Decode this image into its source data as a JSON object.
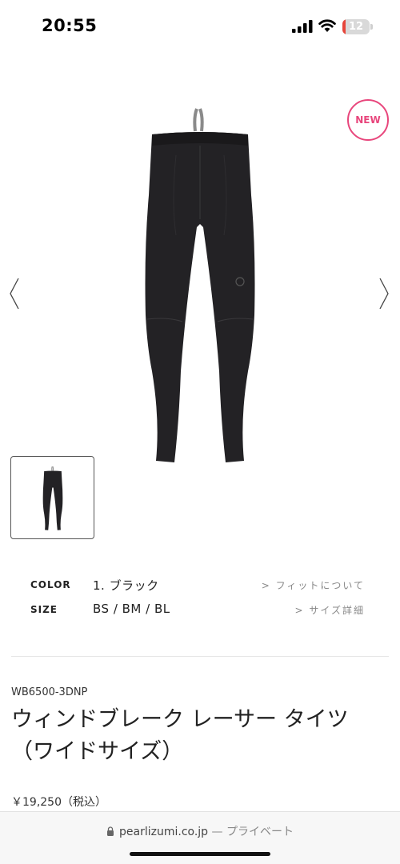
{
  "status_bar": {
    "time": "20:55",
    "battery_level": "12",
    "battery_fraction": 0.12,
    "battery_color": "#e6453a",
    "icons": [
      "signal-icon",
      "wifi-icon",
      "battery-icon"
    ]
  },
  "hero": {
    "badge": "NEW",
    "badge_color": "#e8467c",
    "prev_icon": "chevron-left-icon",
    "next_icon": "chevron-right-icon"
  },
  "specs": {
    "color_label": "COLOR",
    "color_value": "1. ブラック",
    "fit_link": "> フィットについて",
    "size_label": "SIZE",
    "size_value": "BS / BM / BL",
    "size_link": "> サイズ詳細"
  },
  "product": {
    "code": "WB6500-3DNP",
    "name": "ウィンドブレーク レーサー タイツ（ワイドサイズ）",
    "price": "￥19,250（税込）"
  },
  "browser": {
    "domain": "pearlizumi.co.jp",
    "separator": " — ",
    "mode": "プライベート"
  }
}
